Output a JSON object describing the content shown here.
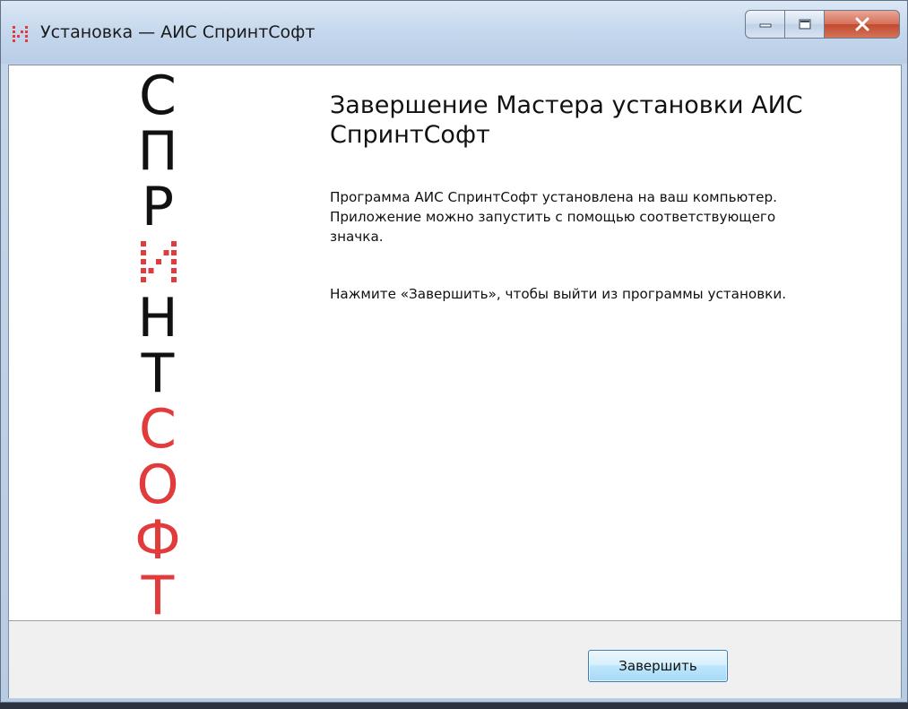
{
  "window": {
    "title": "Установка — АИС СпринтСофт",
    "controls": [
      "minimize-icon",
      "maximize-icon",
      "close-icon"
    ]
  },
  "logo": {
    "letters": [
      {
        "char": "С",
        "color": "#111111"
      },
      {
        "char": "П",
        "color": "#111111"
      },
      {
        "char": "Р",
        "color": "#111111"
      },
      {
        "char": "И",
        "color": "#e23b3b",
        "dotted": true
      },
      {
        "char": "Н",
        "color": "#111111"
      },
      {
        "char": "Т",
        "color": "#111111"
      },
      {
        "char": "С",
        "color": "#e23b3b"
      },
      {
        "char": "О",
        "color": "#e23b3b"
      },
      {
        "char": "Ф",
        "color": "#e23b3b"
      },
      {
        "char": "Т",
        "color": "#e23b3b"
      }
    ]
  },
  "main": {
    "heading": "Завершение Мастера установки АИС СпринтСофт",
    "paragraph1": "Программа АИС СпринтСофт установлена на ваш компьютер. Приложение можно запустить с помощью соответствующего значка.",
    "paragraph2": "Нажмите «Завершить», чтобы выйти из программы установки."
  },
  "footer": {
    "finish_label": "Завершить"
  },
  "colors": {
    "accent_red": "#e23b3b",
    "text": "#111111"
  }
}
